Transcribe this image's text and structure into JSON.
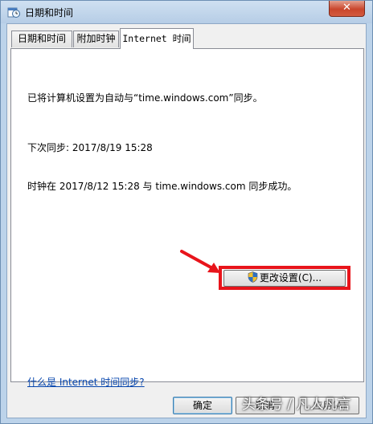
{
  "window": {
    "title": "日期和时间",
    "close_label": "✕"
  },
  "tabs": [
    {
      "label": "日期和时间"
    },
    {
      "label": "附加时钟"
    },
    {
      "label": "Internet 时间"
    }
  ],
  "content": {
    "sync_status": "已将计算机设置为自动与“time.windows.com”同步。",
    "next_sync": "下次同步: 2017/8/19 15:28",
    "last_sync": "时钟在 2017/8/12 15:28 与 time.windows.com 同步成功。",
    "change_settings_label": "更改设置(C)...",
    "help_link": "什么是 Internet 时间同步?"
  },
  "buttons": {
    "ok": "确定",
    "cancel": "取消",
    "apply": "应用(A)"
  },
  "watermark": "头条号 / 凡人凡言",
  "colors": {
    "highlight": "#e8141b",
    "link": "#0645ad"
  }
}
